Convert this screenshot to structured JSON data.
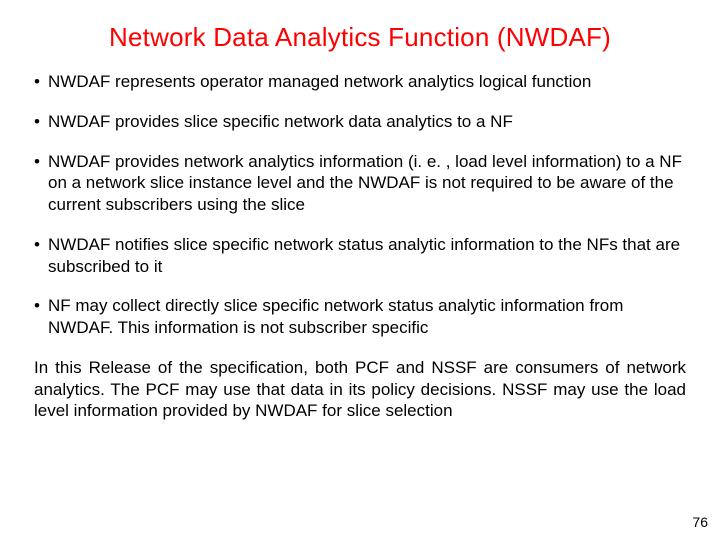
{
  "title": "Network Data Analytics Function (NWDAF)",
  "bullets": [
    "NWDAF represents operator managed network analytics logical function",
    "NWDAF provides slice specific network data analytics to a NF",
    "NWDAF provides network analytics information (i. e. , load level information) to a NF on a network slice instance level and the NWDAF is not required to be aware of the current subscribers using the slice",
    "NWDAF notifies slice specific network status analytic information to the NFs that are subscribed to it",
    "NF may collect directly slice specific network status analytic information from NWDAF. This information is not subscriber specific"
  ],
  "paragraph": "In this Release of the specification, both PCF and NSSF are consumers of network analytics. The PCF may use that data in its policy decisions. NSSF may use the load level information provided by NWDAF for slice selection",
  "page_number": "76"
}
